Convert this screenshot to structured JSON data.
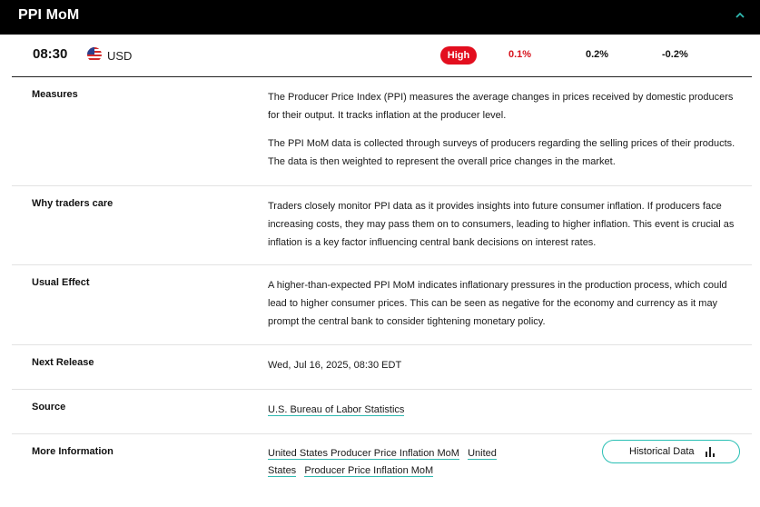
{
  "header": {
    "title": "PPI MoM"
  },
  "event": {
    "time": "08:30",
    "currency": "USD",
    "impact": "High",
    "actual": "0.1%",
    "forecast": "0.2%",
    "previous": "-0.2%",
    "impact_color": "#e30e1e",
    "actual_color": "#d7141e"
  },
  "details": {
    "measures": {
      "label": "Measures",
      "p1": "The Producer Price Index (PPI) measures the average changes in prices received by domestic producers for their output. It tracks inflation at the producer level.",
      "p2": "The PPI MoM data is collected through surveys of producers regarding the selling prices of their products. The data is then weighted to represent the overall price changes in the market."
    },
    "why": {
      "label": "Why traders care",
      "text": "Traders closely monitor PPI data as it provides insights into future consumer inflation. If producers face increasing costs, they may pass them on to consumers, leading to higher inflation. This event is crucial as inflation is a key factor influencing central bank decisions on interest rates."
    },
    "effect": {
      "label": "Usual Effect",
      "text": "A higher-than-expected PPI MoM indicates inflationary pressures in the production process, which could lead to higher consumer prices. This can be seen as negative for the economy and currency as it may prompt the central bank to consider tightening monetary policy."
    },
    "next": {
      "label": "Next Release",
      "text": "Wed, Jul 16, 2025, 08:30 EDT"
    },
    "source": {
      "label": "Source",
      "link": "U.S. Bureau of Labor Statistics"
    },
    "more": {
      "label": "More Information",
      "link1": "United States Producer Price Inflation MoM",
      "link2": "United States",
      "link3": "Producer Price Inflation MoM",
      "button": "Historical Data"
    }
  },
  "icons": {
    "collapse": "chevron-up-icon",
    "flag": "us-flag-icon",
    "chart": "bar-chart-icon"
  },
  "colors": {
    "header_bg": "#000000",
    "accent": "#2fb9b0"
  }
}
